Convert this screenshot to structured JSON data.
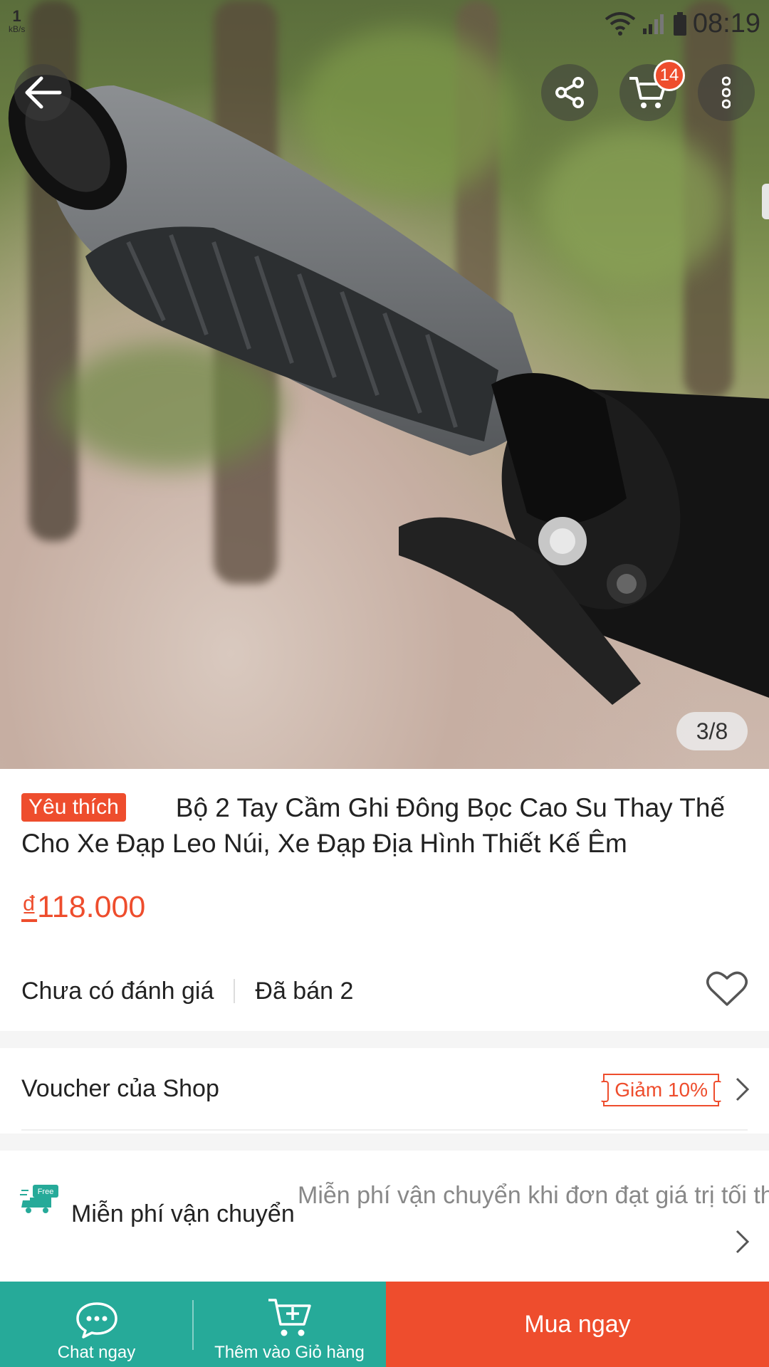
{
  "status_bar": {
    "net_speed_value": "1",
    "net_speed_unit": "kB/s",
    "time": "08:19"
  },
  "hero": {
    "image_counter": "3/8",
    "cart_count": "14"
  },
  "product": {
    "badge": "Yêu thích",
    "title": "Bộ 2 Tay Cầm Ghi Đông Bọc Cao Su Thay Thế Cho Xe Đạp Leo Núi, Xe Đạp Địa Hình Thiết Kế Êm",
    "currency": "₫",
    "price": "118.000",
    "rating_text": "Chưa có đánh giá",
    "sold_text": "Đã bán 2"
  },
  "voucher": {
    "label": "Voucher của Shop",
    "tag": "Giảm 10%"
  },
  "shipping": {
    "icon_text": "Free",
    "label": "Miễn phí vận chuyển",
    "description": "Miễn phí vận chuyển khi đơn đạt giá trị tối thiểu"
  },
  "bottom_bar": {
    "chat_label": "Chat ngay",
    "add_cart_label": "Thêm vào Giỏ hàng",
    "buy_label": "Mua ngay"
  },
  "colors": {
    "accent": "#ee4d2d",
    "teal": "#26aa99"
  }
}
